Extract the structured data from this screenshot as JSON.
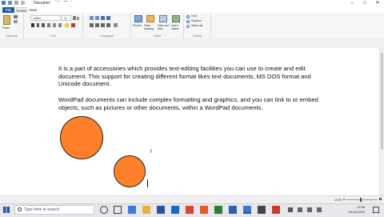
{
  "window": {
    "title": "Document - WordPad",
    "minimize": "–",
    "maximize": "□",
    "close": "✕"
  },
  "menu": {
    "file": "File",
    "home": "Home",
    "view": "View"
  },
  "ribbon": {
    "clipboard": {
      "group_label": "Clipboard",
      "paste": "Paste"
    },
    "font": {
      "group_label": "Font",
      "font_name": "Calibri",
      "font_size": "11"
    },
    "paragraph": {
      "group_label": "Paragraph"
    },
    "insert": {
      "group_label": "Insert",
      "picture": "Picture",
      "paint_drawing": "Paint drawing",
      "date_time": "Date and time",
      "insert_object": "Insert object"
    },
    "editing": {
      "group_label": "Editing",
      "find": "Find",
      "replace": "Replace",
      "select_all": "Select all"
    }
  },
  "document": {
    "para1": "It is a part of accessories which provides text-editing facilities you can use to create and edit document. This support for creating different format likes text documents, MS DOS format and Unicode document.",
    "para2": "WordPad documents can include complex formatting and graphics, and you can link to or embed objects, such as pictures or other documents, within a WordPad documents.",
    "shape_color": "#ff7f2a"
  },
  "status": {
    "zoom": "100%"
  },
  "taskbar": {
    "search_placeholder": "Type here to search",
    "time": "11:56",
    "date": "04-06-2020"
  }
}
